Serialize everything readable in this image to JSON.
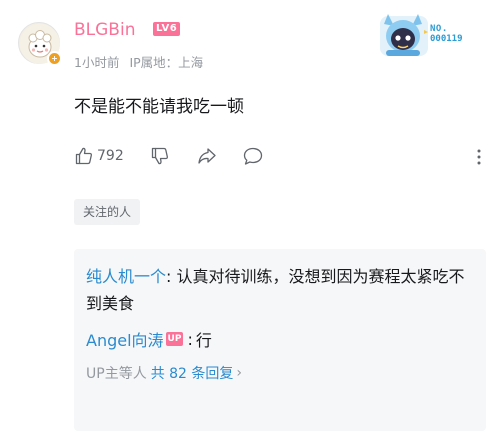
{
  "comment": {
    "username": "BLGBin",
    "level": "LV6",
    "time": "1小时前",
    "ip_location": "IP属地：上海",
    "text": "不是能不能请我吃一顿",
    "likes": "792",
    "follow_tag": "关注的人"
  },
  "fan_badge": {
    "no_label": "NO.",
    "no_value": "000119"
  },
  "replies": {
    "first": {
      "author": "纯人机一个",
      "separator": ": ",
      "text": "认真对待训练，没想到因为赛程太紧吃不到美食"
    },
    "second": {
      "author": "Angel向涛",
      "badge": "UP",
      "separator": " : ",
      "text": "行"
    },
    "more": {
      "prefix": "UP主等人",
      "count_text": "共 82 条回复",
      "chevron": "›"
    }
  },
  "colors": {
    "username": "#fb7299",
    "reply_author": "#2a8bd0",
    "meta": "#9499a0"
  }
}
